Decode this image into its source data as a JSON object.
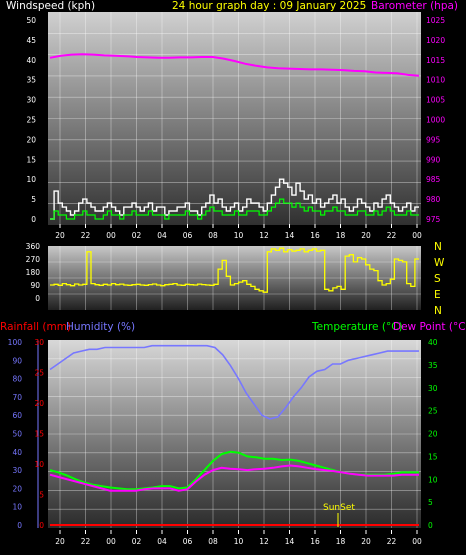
{
  "title": "24 hour graph day : 09 January 2025",
  "x_ticks": [
    "20",
    "22",
    "00",
    "02",
    "04",
    "06",
    "08",
    "10",
    "12",
    "14",
    "16",
    "18",
    "20",
    "22",
    "00"
  ],
  "colors": {
    "wind_avg": "#00ff00",
    "wind_gust": "#ffffff",
    "barometer": "#ff00ff",
    "direction": "#ffff00",
    "rainfall": "#ff0000",
    "humidity": "#7777ff",
    "temperature": "#00ff00",
    "dewpoint": "#ff00ff",
    "tick": "#ffff00",
    "event": "#ffff00"
  },
  "chart_data": [
    {
      "type": "line",
      "id": "wind_pressure",
      "xlabel": "",
      "left_axis": {
        "label": "Windspeed (kph)",
        "ticks": [
          "0",
          "5",
          "10",
          "15",
          "20",
          "25",
          "30",
          "35",
          "40",
          "45",
          "50"
        ],
        "ylim": [
          0,
          50
        ]
      },
      "right_axis": {
        "label": "Barometer (hpa)",
        "ticks": [
          "975",
          "980",
          "985",
          "990",
          "995",
          "1000",
          "1005",
          "1010",
          "1015",
          "1020",
          "1025"
        ],
        "ylim": [
          975,
          1025
        ]
      },
      "x_hours": [
        0,
        1,
        2,
        3,
        4,
        5,
        6,
        7,
        8,
        9,
        10,
        11,
        12,
        13,
        14,
        15,
        16,
        17,
        18,
        19,
        20,
        21,
        22,
        23,
        24
      ],
      "series": [
        {
          "name": "Barometer",
          "axis": "right",
          "values": [
            1015.5,
            1016.0,
            1016.3,
            1016.4,
            1016.3,
            1016.1,
            1016.0,
            1015.9,
            1015.7,
            1015.6,
            1015.5,
            1015.5,
            1015.6,
            1015.6,
            1015.7,
            1015.7,
            1015.3,
            1014.7,
            1014.0,
            1013.5,
            1013.1,
            1012.9,
            1012.8,
            1012.7,
            1012.6,
            1012.6,
            1012.5,
            1012.4,
            1012.2,
            1012.1,
            1011.8,
            1011.7,
            1011.6,
            1011.2,
            1011.0
          ]
        },
        {
          "name": "Gust",
          "axis": "left",
          "values": [
            0,
            7,
            4,
            3,
            2,
            1,
            2,
            4,
            5,
            4,
            3,
            2,
            2,
            3,
            4,
            3,
            2,
            1,
            3,
            3,
            4,
            3,
            2,
            3,
            4,
            2,
            3,
            3,
            1,
            2,
            2,
            3,
            3,
            4,
            2,
            2,
            1,
            3,
            4,
            6,
            4,
            5,
            3,
            2,
            3,
            4,
            2,
            3,
            5,
            4,
            4,
            3,
            2,
            4,
            6,
            8,
            10,
            9,
            8,
            6,
            9,
            7,
            5,
            6,
            4,
            5,
            3,
            4,
            5,
            6,
            4,
            5,
            3,
            2,
            3,
            5,
            4,
            3,
            2,
            4,
            3,
            5,
            6,
            4,
            3,
            2,
            3,
            4,
            2,
            3
          ]
        },
        {
          "name": "Average",
          "axis": "left",
          "values": [
            0,
            2,
            1,
            1,
            0,
            0,
            1,
            1,
            2,
            1,
            1,
            0,
            0,
            1,
            2,
            1,
            1,
            0,
            1,
            1,
            2,
            1,
            1,
            1,
            2,
            1,
            1,
            1,
            0,
            1,
            1,
            1,
            1,
            2,
            1,
            1,
            0,
            1,
            2,
            3,
            2,
            2,
            1,
            1,
            1,
            2,
            1,
            1,
            2,
            2,
            2,
            1,
            1,
            2,
            3,
            4,
            5,
            4,
            4,
            3,
            4,
            3,
            2,
            3,
            2,
            2,
            1,
            2,
            2,
            3,
            2,
            2,
            1,
            1,
            1,
            2,
            2,
            1,
            1,
            2,
            1,
            2,
            3,
            2,
            1,
            1,
            1,
            2,
            1,
            1
          ]
        }
      ]
    },
    {
      "type": "line",
      "id": "wind_direction",
      "left_axis": {
        "ticks": [
          "0",
          "90",
          "180",
          "270",
          "360"
        ],
        "ylim": [
          0,
          360
        ]
      },
      "right_labels": [
        "N",
        "W",
        "S",
        "E",
        "N"
      ],
      "series": [
        {
          "name": "Direction",
          "values": [
            90,
            95,
            88,
            100,
            92,
            85,
            97,
            90,
            95,
            320,
            100,
            92,
            88,
            95,
            90,
            100,
            92,
            96,
            90,
            88,
            92,
            95,
            90,
            88,
            93,
            97,
            90,
            85,
            92,
            95,
            100,
            90,
            88,
            95,
            92,
            90,
            96,
            93,
            90,
            88,
            95,
            200,
            260,
            150,
            90,
            100,
            110,
            120,
            95,
            80,
            60,
            50,
            40,
            320,
            340,
            330,
            345,
            320,
            335,
            325,
            330,
            340,
            320,
            330,
            340,
            325,
            330,
            60,
            50,
            70,
            80,
            60,
            290,
            300,
            250,
            280,
            270,
            230,
            200,
            190,
            120,
            90,
            100,
            130,
            270,
            260,
            250,
            100,
            80,
            270
          ]
        }
      ]
    },
    {
      "type": "line",
      "id": "temp_humidity",
      "left_labels": [
        "Rainfall (mm)",
        "Humidity (%)"
      ],
      "right_labels": [
        "Temperature (°C)",
        "Dew Point (°C)"
      ],
      "humidity_axis": {
        "ticks": [
          "0",
          "10",
          "20",
          "30",
          "40",
          "50",
          "60",
          "70",
          "80",
          "90",
          "100"
        ],
        "ylim": [
          0,
          100
        ]
      },
      "rain_axis": {
        "ticks": [
          "0",
          "5",
          "10",
          "15",
          "20",
          "25",
          "30"
        ],
        "ylim": [
          0,
          30
        ]
      },
      "temp_axis": {
        "ticks": [
          "0",
          "5",
          "10",
          "15",
          "20",
          "25",
          "30",
          "35",
          "40"
        ],
        "ylim": [
          0,
          40
        ]
      },
      "event_label": "SunSet",
      "series": [
        {
          "name": "Humidity",
          "axis": "humidity",
          "values": [
            85,
            88,
            91,
            94,
            95,
            96,
            96,
            97,
            97,
            97,
            97,
            97,
            97,
            98,
            98,
            98,
            98,
            98,
            98,
            98,
            98,
            97,
            93,
            87,
            80,
            72,
            66,
            60,
            58,
            59,
            64,
            70,
            75,
            81,
            84,
            85,
            88,
            88,
            90,
            91,
            92,
            93,
            94,
            95,
            95,
            95,
            95,
            95
          ]
        },
        {
          "name": "Temperature",
          "axis": "temp",
          "values": [
            12.0,
            11.5,
            10.8,
            10.0,
            9.3,
            8.8,
            8.5,
            8.2,
            8.0,
            7.8,
            7.8,
            8.0,
            8.2,
            8.5,
            8.5,
            8.0,
            8.2,
            10.0,
            12.0,
            14.0,
            15.5,
            16.0,
            15.8,
            15.0,
            14.8,
            14.5,
            14.5,
            14.2,
            14.3,
            14.0,
            13.5,
            13.0,
            12.5,
            12.0,
            11.5,
            11.2,
            11.0,
            11.0,
            11.0,
            11.0,
            11.2,
            11.5,
            11.5,
            11.5
          ]
        },
        {
          "name": "Dew Point",
          "axis": "temp",
          "values": [
            11.0,
            10.5,
            10.0,
            9.5,
            9.0,
            8.5,
            8.0,
            7.5,
            7.5,
            7.5,
            7.5,
            7.8,
            8.0,
            8.0,
            8.0,
            7.5,
            7.8,
            9.5,
            11.0,
            12.0,
            12.5,
            12.3,
            12.2,
            12.0,
            12.2,
            12.3,
            12.5,
            12.8,
            13.0,
            12.8,
            12.5,
            12.2,
            12.0,
            11.8,
            11.5,
            11.2,
            11.0,
            10.8,
            10.8,
            10.8,
            10.8,
            11.0,
            11.0,
            11.0
          ]
        },
        {
          "name": "Rainfall",
          "axis": "rain",
          "values": [
            0,
            0,
            0,
            0,
            0,
            0,
            0,
            0,
            0,
            0,
            0,
            0,
            0,
            0,
            0,
            0,
            0,
            0,
            0,
            0,
            0,
            0,
            0,
            0,
            0
          ]
        }
      ]
    }
  ]
}
